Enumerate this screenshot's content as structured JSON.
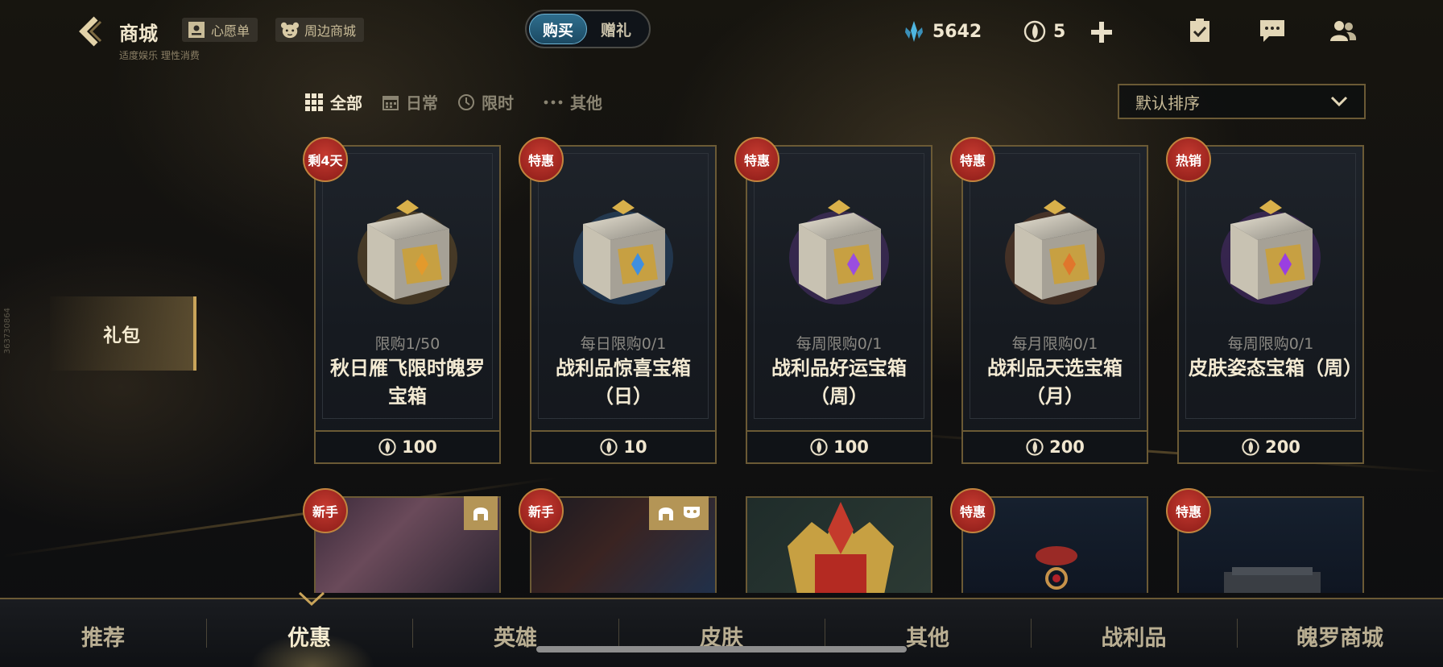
{
  "header": {
    "title": "商城",
    "subtitle": "适度娱乐 理性消费",
    "wishlist_label": "心愿单",
    "merch_label": "周边商城",
    "mode_tabs": [
      {
        "label": "购买",
        "active": true
      },
      {
        "label": "赠礼",
        "active": false
      }
    ],
    "blue_essence": "5642",
    "orb_count": "5"
  },
  "filters": [
    {
      "label": "全部",
      "active": true,
      "icon": "grid-icon"
    },
    {
      "label": "日常",
      "active": false,
      "icon": "calendar-icon"
    },
    {
      "label": "限时",
      "active": false,
      "icon": "clock-icon"
    },
    {
      "label": "其他",
      "active": false,
      "icon": "more-icon"
    }
  ],
  "sort": {
    "label": "默认排序"
  },
  "side_tab": {
    "label": "礼包"
  },
  "side_code": "363730864",
  "cards": [
    {
      "badge": "剩4天",
      "limit": "限购1/50",
      "name": "秋日雁飞限时魄罗宝箱",
      "price": "100",
      "accent": "#e39a2c"
    },
    {
      "badge": "特惠",
      "limit": "每日限购0/1",
      "name": "战利品惊喜宝箱（日）",
      "price": "10",
      "accent": "#3f8fe0"
    },
    {
      "badge": "特惠",
      "limit": "每周限购0/1",
      "name": "战利品好运宝箱（周）",
      "price": "100",
      "accent": "#9a4de0"
    },
    {
      "badge": "特惠",
      "limit": "每月限购0/1",
      "name": "战利品天选宝箱（月）",
      "price": "200",
      "accent": "#e0762c"
    },
    {
      "badge": "热销",
      "limit": "每周限购0/1",
      "name": "皮肤姿态宝箱（周）",
      "price": "200",
      "accent": "#9a3fe0"
    }
  ],
  "second_row": [
    {
      "badge": "新手"
    },
    {
      "badge": "新手"
    },
    {
      "badge": ""
    },
    {
      "badge": "特惠"
    },
    {
      "badge": "特惠"
    }
  ],
  "bottom_nav": [
    {
      "label": "推荐",
      "active": false
    },
    {
      "label": "优惠",
      "active": true
    },
    {
      "label": "英雄",
      "active": false
    },
    {
      "label": "皮肤",
      "active": false
    },
    {
      "label": "其他",
      "active": false
    },
    {
      "label": "战利品",
      "active": false
    },
    {
      "label": "魄罗商城",
      "active": false
    }
  ]
}
